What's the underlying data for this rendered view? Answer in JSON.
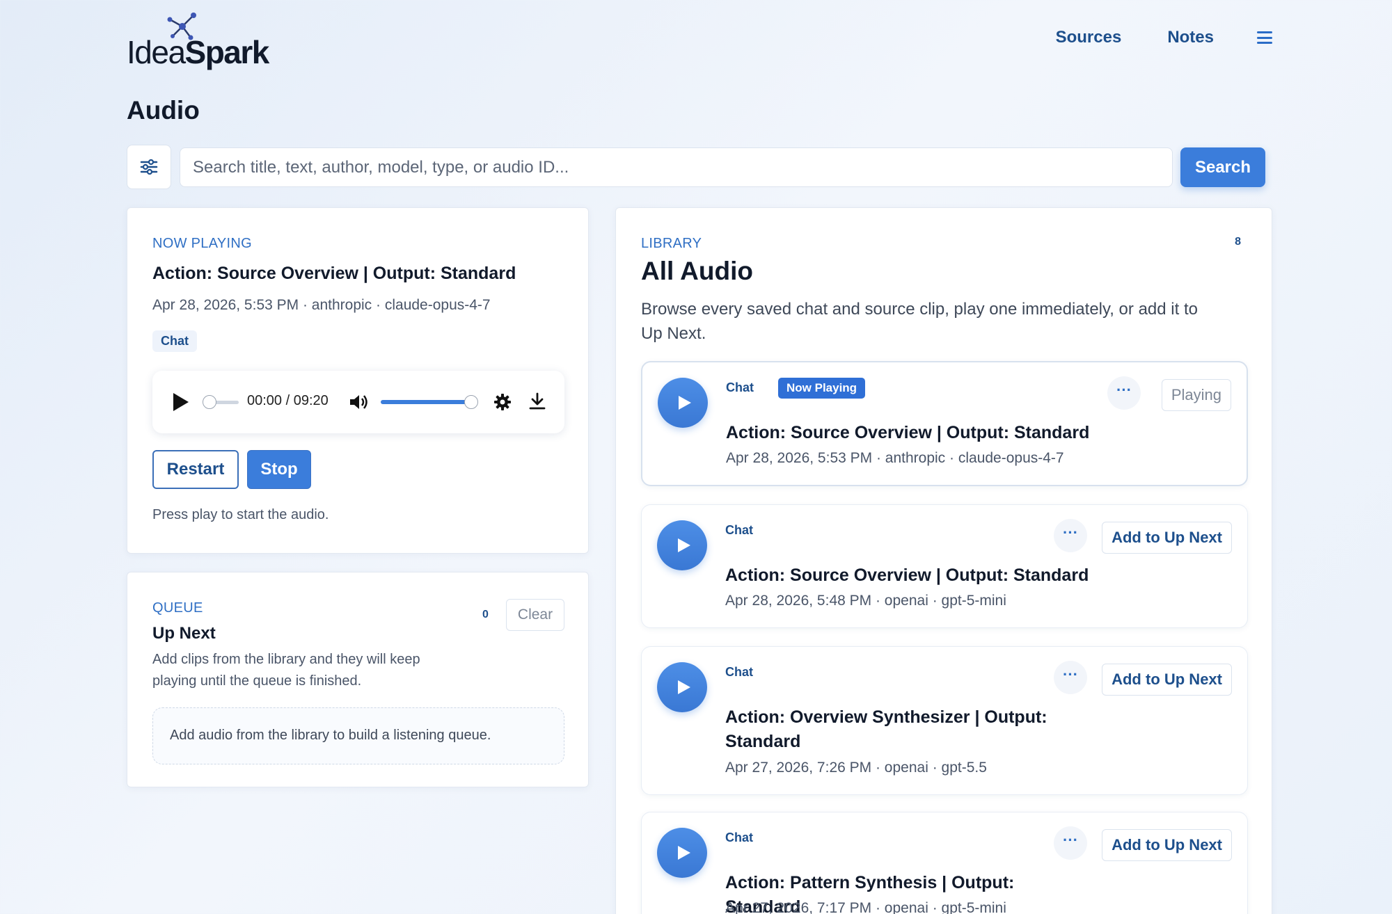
{
  "brand": {
    "prefix": "Idea",
    "suffix": "Spark"
  },
  "nav": {
    "sources": "Sources",
    "notes": "Notes"
  },
  "page": {
    "title": "Audio"
  },
  "search": {
    "placeholder": "Search title, text, author, model, type, or audio ID...",
    "button": "Search"
  },
  "now_playing": {
    "eyebrow": "NOW PLAYING",
    "title": "Action: Source Overview | Output: Standard",
    "meta": "Apr 28, 2026, 5:53 PM · anthropic · claude-opus-4-7",
    "chip": "Chat",
    "player": {
      "current_time": "00:00",
      "separator": "/",
      "duration": "09:20",
      "volume_level": 0.95
    },
    "restart": "Restart",
    "stop": "Stop",
    "hint": "Press play to start the audio."
  },
  "queue": {
    "eyebrow": "QUEUE",
    "count": "0",
    "clear": "Clear",
    "title": "Up Next",
    "description": "Add clips from the library and they will keep playing until the queue is finished.",
    "empty": "Add audio from the library to build a listening queue."
  },
  "library": {
    "eyebrow": "LIBRARY",
    "count": "8",
    "title": "All Audio",
    "description": "Browse every saved chat and source clip, play one immediately, or add it to Up Next.",
    "items": [
      {
        "chip": "Chat",
        "badge": "Now Playing",
        "action": "Playing",
        "title": "Action: Source Overview | Output: Standard",
        "meta": "Apr 28, 2026, 5:53 PM · anthropic · claude-opus-4-7"
      },
      {
        "chip": "Chat",
        "action": "Add to Up Next",
        "title": "Action: Source Overview | Output: Standard",
        "meta": "Apr 28, 2026, 5:48 PM · openai · gpt-5-mini"
      },
      {
        "chip": "Chat",
        "action": "Add to Up Next",
        "title": "Action: Overview Synthesizer | Output: Standard",
        "meta": "Apr 27, 2026, 7:26 PM · openai · gpt-5.5"
      },
      {
        "chip": "Chat",
        "action": "Add to Up Next",
        "title": "Action: Pattern Synthesis | Output: Standard",
        "meta": "Apr 27, 2026, 7:17 PM · openai · gpt-5-mini"
      }
    ]
  },
  "colors": {
    "accent": "#3b7ddb",
    "link": "#1d4f8c"
  }
}
